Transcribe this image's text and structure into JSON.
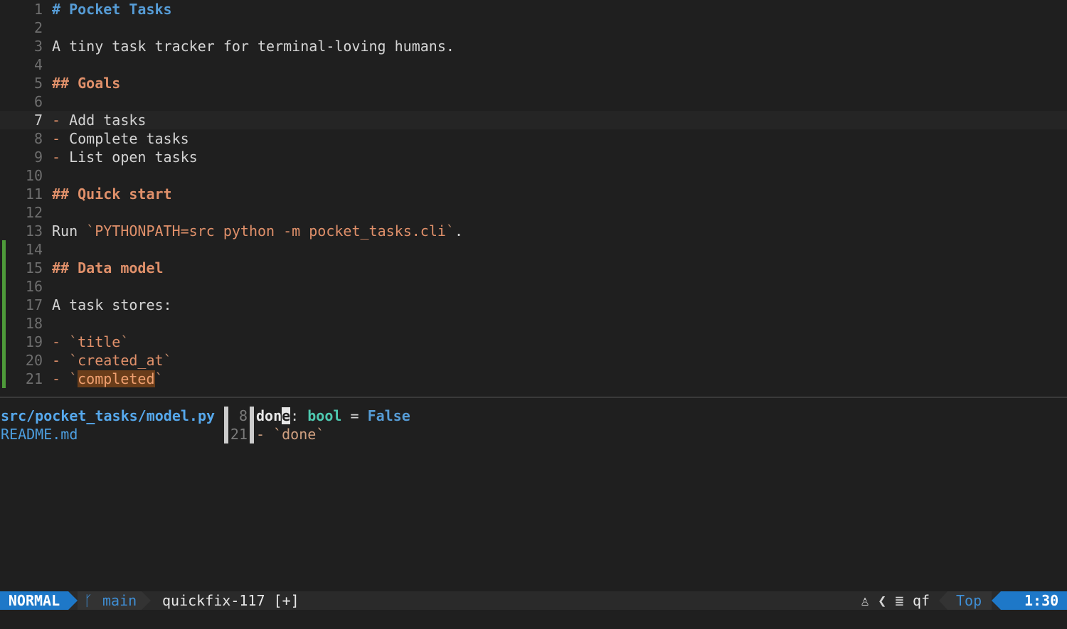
{
  "editor": {
    "lines": [
      {
        "n": "1",
        "segments": [
          {
            "t": "# Pocket Tasks",
            "c": "h1"
          }
        ]
      },
      {
        "n": "2",
        "segments": []
      },
      {
        "n": "3",
        "segments": [
          {
            "t": "A tiny task tracker for terminal-loving humans.",
            "c": ""
          }
        ]
      },
      {
        "n": "4",
        "segments": []
      },
      {
        "n": "5",
        "segments": [
          {
            "t": "## Goals",
            "c": "h2"
          }
        ]
      },
      {
        "n": "6",
        "segments": []
      },
      {
        "n": "7",
        "cursorline": true,
        "segments": [
          {
            "t": "-",
            "c": "listmark"
          },
          {
            "t": " Add tasks",
            "c": ""
          }
        ]
      },
      {
        "n": "8",
        "segments": [
          {
            "t": "-",
            "c": "listmark"
          },
          {
            "t": " Complete tasks",
            "c": ""
          }
        ]
      },
      {
        "n": "9",
        "segments": [
          {
            "t": "-",
            "c": "listmark"
          },
          {
            "t": " List open tasks",
            "c": ""
          }
        ]
      },
      {
        "n": "10",
        "segments": []
      },
      {
        "n": "11",
        "segments": [
          {
            "t": "## Quick start",
            "c": "h2"
          }
        ]
      },
      {
        "n": "12",
        "segments": []
      },
      {
        "n": "13",
        "segments": [
          {
            "t": "Run ",
            "c": ""
          },
          {
            "t": "`",
            "c": "tick"
          },
          {
            "t": "PYTHONPATH=src python -m pocket_tasks.cli",
            "c": "code"
          },
          {
            "t": "`",
            "c": "tick"
          },
          {
            "t": ".",
            "c": ""
          }
        ]
      },
      {
        "n": "14",
        "sign": "added",
        "segments": []
      },
      {
        "n": "15",
        "sign": "added",
        "segments": [
          {
            "t": "## Data model",
            "c": "h2"
          }
        ]
      },
      {
        "n": "16",
        "sign": "added",
        "segments": []
      },
      {
        "n": "17",
        "sign": "added",
        "segments": [
          {
            "t": "A task stores:",
            "c": ""
          }
        ]
      },
      {
        "n": "18",
        "sign": "added",
        "segments": []
      },
      {
        "n": "19",
        "sign": "added",
        "segments": [
          {
            "t": "-",
            "c": "listmark"
          },
          {
            "t": " ",
            "c": ""
          },
          {
            "t": "`",
            "c": "tick"
          },
          {
            "t": "title",
            "c": "code"
          },
          {
            "t": "`",
            "c": "tick"
          }
        ]
      },
      {
        "n": "20",
        "sign": "added",
        "segments": [
          {
            "t": "-",
            "c": "listmark"
          },
          {
            "t": " ",
            "c": ""
          },
          {
            "t": "`",
            "c": "tick"
          },
          {
            "t": "created_at",
            "c": "code"
          },
          {
            "t": "`",
            "c": "tick"
          }
        ]
      },
      {
        "n": "21",
        "sign": "added",
        "segments": [
          {
            "t": "-",
            "c": "listmark"
          },
          {
            "t": " ",
            "c": ""
          },
          {
            "t": "`",
            "c": "tick"
          },
          {
            "t": "completed",
            "c": "code searchhl"
          },
          {
            "t": "`",
            "c": "tick"
          }
        ]
      }
    ]
  },
  "quickfix": {
    "rows": [
      {
        "file": "src/pocket_tasks/model.py",
        "lnum": "8",
        "active": true,
        "segments": [
          {
            "t": "don",
            "c": "kw-name"
          },
          {
            "t": "e",
            "c": "kw-name qf-cursor"
          },
          {
            "t": ": ",
            "c": ""
          },
          {
            "t": "bool",
            "c": "kw-type"
          },
          {
            "t": " = ",
            "c": ""
          },
          {
            "t": "False",
            "c": "kw-const"
          }
        ]
      },
      {
        "file": "README.md",
        "lnum": "21",
        "active": false,
        "segments": [
          {
            "t": "- `done`",
            "c": ""
          }
        ]
      }
    ]
  },
  "statusline": {
    "mode": "NORMAL",
    "branch_icon": "git-branch-icon",
    "branch": "main",
    "file": "quickfix-117 [+]",
    "os_icon": "linux-penguin-icon",
    "sep_icon": "chevron-left-icon",
    "list_icon": "list-lines-icon",
    "filetype": "qf",
    "position": "Top",
    "location": "1:30"
  },
  "colors": {
    "background": "#1f1f1f",
    "accent": "#1e78c8",
    "heading1": "#569cd6",
    "heading2": "#e0906a",
    "git_added": "#4e9a3a"
  }
}
